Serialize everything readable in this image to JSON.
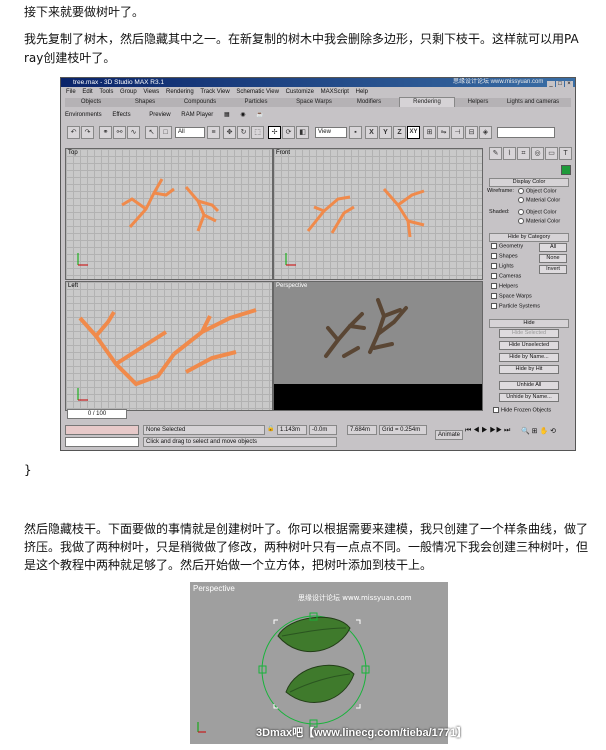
{
  "intro": "接下来就要做树叶了。",
  "para2": "我先复制了树木，然后隐藏其中之一。在新复制的树木中我会删除多边形，只剩下枝干。这样就可以用PA ray创建枝叶了。",
  "closing_brace": "}",
  "para3": "然后隐藏枝干。下面要做的事情就是创建树叶了。你可以根据需要来建模，我只创建了一个样条曲线，做了挤压。我做了两种树叶，只是稍微做了修改，两种树叶只有一点点不同。一般情况下我会创建三种树叶，但是这个教程中两种就足够了。然后开始做一个立方体，把树叶添加到枝干上。",
  "max": {
    "title": "tree.max - 3D Studio MAX R3.1",
    "watermark": "思缘设计论坛 www.missyuan.com",
    "menu": [
      "File",
      "Edit",
      "Tools",
      "Group",
      "Views",
      "Rendering",
      "Track View",
      "Schematic View",
      "Customize",
      "MAXScript",
      "Help"
    ],
    "tabs": [
      "Objects",
      "Shapes",
      "Compounds",
      "Particles",
      "Space Warps",
      "Modifiers",
      "Rendering",
      "Helpers",
      "Lights and cameras"
    ],
    "active_tab": "Rendering",
    "tabs2": [
      "Environments",
      "Effects",
      "Preview",
      "RAM Player"
    ],
    "toolbar_select": "All",
    "toolbar_view": "View",
    "axis_labels": [
      "X",
      "Y",
      "Z",
      "XY"
    ],
    "viewports": [
      "Top",
      "Front",
      "Left",
      "Perspective"
    ],
    "panel": {
      "display_color": "Display Color",
      "wireframe": "Wireframe:",
      "shaded": "Shaded:",
      "object_color": "Object Color",
      "material_color": "Material Color",
      "hide_by_category": "Hide by Category",
      "categories": [
        "Geometry",
        "Shapes",
        "Lights",
        "Cameras",
        "Helpers",
        "Space Warps",
        "Particle Systems"
      ],
      "all": "All",
      "none": "None",
      "invert": "Invert",
      "hide": "Hide",
      "hide_buttons": [
        "Hide Selected",
        "Hide Unselected",
        "Hide by Name...",
        "Hide by Hit"
      ],
      "unhide_buttons": [
        "Unhide All",
        "Unhide by Name..."
      ],
      "hide_frozen": "Hide Frozen Objects"
    },
    "frame": "0 / 100",
    "status": {
      "selection": "None Selected",
      "prompt": "Click and drag to select and move objects",
      "x": "1.143m",
      "y": "-0.0m",
      "z": "7.684m",
      "grid": "Grid = 0.254m",
      "animate": "Animate"
    }
  },
  "leaf_image": {
    "viewport_label": "Perspective",
    "watermark": "思缘设计论坛 www.missyuan.com",
    "caption": "3Dmax吧【www.linecg.com/tieba/1771】"
  }
}
